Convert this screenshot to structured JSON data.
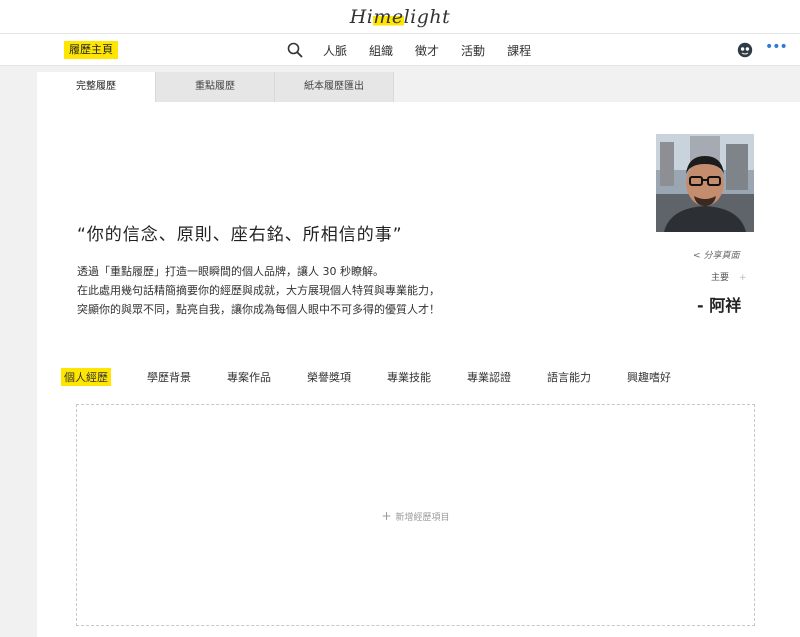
{
  "brand": {
    "logo_pre": "Hi",
    "logo_hl": "me",
    "logo_post": "light"
  },
  "nav": {
    "home_label": "履歷主頁",
    "items": [
      "人脈",
      "組織",
      "徵才",
      "活動",
      "課程"
    ],
    "search_icon": "search-icon",
    "avatar_icon": "user-avatar-icon",
    "more_icon": "more-dots-icon"
  },
  "tabs": [
    "完整履歷",
    "重點履歷",
    "紙本履歷匯出"
  ],
  "profile": {
    "quote": "“你的信念、原則、座右銘、所相信的事”",
    "desc_lines": [
      "透過「重點履歷」打造一眼瞬間的個人品牌，讓人 30 秒瞭解。",
      "在此處用幾句話精簡摘要你的經歷與成就，大方展現個人特質與專業能力，",
      "突顯你的與眾不同，點亮自我，讓你成為每個人眼中不可多得的優質人才！"
    ],
    "share_label": "分享頁面",
    "main_label": "主要",
    "main_plus": "+",
    "author": "- 阿祥"
  },
  "section_tabs": [
    "個人經歷",
    "學歷背景",
    "專案作品",
    "榮譽獎項",
    "專業技能",
    "專業認證",
    "語言能力",
    "興趣嗜好"
  ],
  "dropzone": {
    "plus": "+",
    "label": "新增經歷項目"
  },
  "colors": {
    "accent": "#ffe600",
    "link_blue": "#2b7bd6"
  }
}
